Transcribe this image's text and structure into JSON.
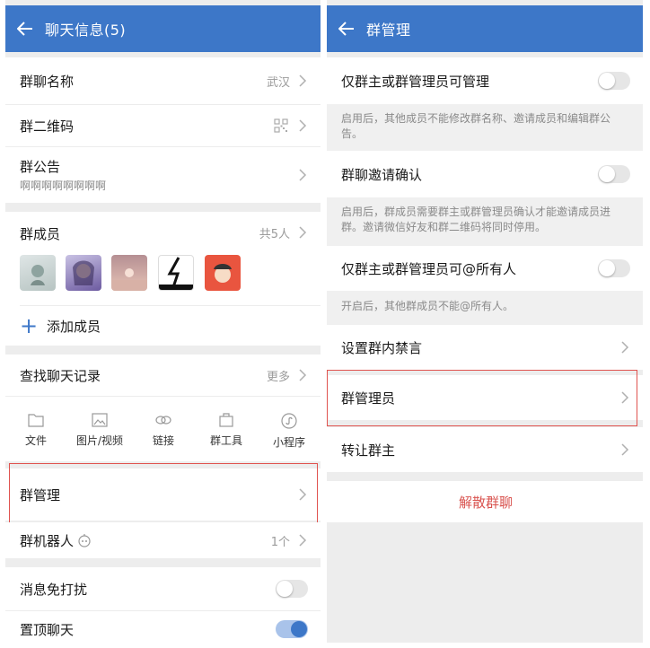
{
  "left": {
    "title": "聊天信息(5)",
    "group_name": {
      "label": "群聊名称",
      "value": "武汉"
    },
    "group_qrcode": {
      "label": "群二维码"
    },
    "announcement": {
      "label": "群公告",
      "text": "啊啊啊啊啊啊啊啊"
    },
    "members": {
      "label": "群成员",
      "count": "共5人"
    },
    "add_member": {
      "icon": "+",
      "label": "添加成员"
    },
    "search_history": {
      "label": "查找聊天记录",
      "more": "更多"
    },
    "tools": [
      {
        "icon": "folder-icon",
        "label": "文件"
      },
      {
        "icon": "image-icon",
        "label": "图片/视频"
      },
      {
        "icon": "link-icon",
        "label": "链接"
      },
      {
        "icon": "toolbox-icon",
        "label": "群工具"
      },
      {
        "icon": "miniprogram-icon",
        "label": "小程序"
      }
    ],
    "group_manage": {
      "label": "群管理"
    },
    "group_robot": {
      "label": "群机器人",
      "value": "1个"
    },
    "mute": {
      "label": "消息免打扰",
      "on": false
    },
    "pin": {
      "label": "置顶聊天",
      "on": true
    }
  },
  "right": {
    "title": "群管理",
    "admin_only_manage": {
      "label": "仅群主或群管理员可管理",
      "on": false,
      "note": "启用后，其他成员不能修改群名称、邀请成员和编辑群公告。"
    },
    "invite_confirm": {
      "label": "群聊邀请确认",
      "on": false,
      "note": "启用后，群成员需要群主或群管理员确认才能邀请成员进群。邀请微信好友和群二维码将同时停用。"
    },
    "at_all": {
      "label": "仅群主或群管理员可@所有人",
      "on": false,
      "note": "开启后，其他群成员不能@所有人。"
    },
    "mute_group": {
      "label": "设置群内禁言"
    },
    "admins": {
      "label": "群管理员"
    },
    "transfer_owner": {
      "label": "转让群主"
    },
    "dissolve": {
      "label": "解散群聊"
    }
  },
  "colors": {
    "accent": "#3d77c8",
    "highlight_border": "#e0534f",
    "danger_text": "#d9534f"
  }
}
